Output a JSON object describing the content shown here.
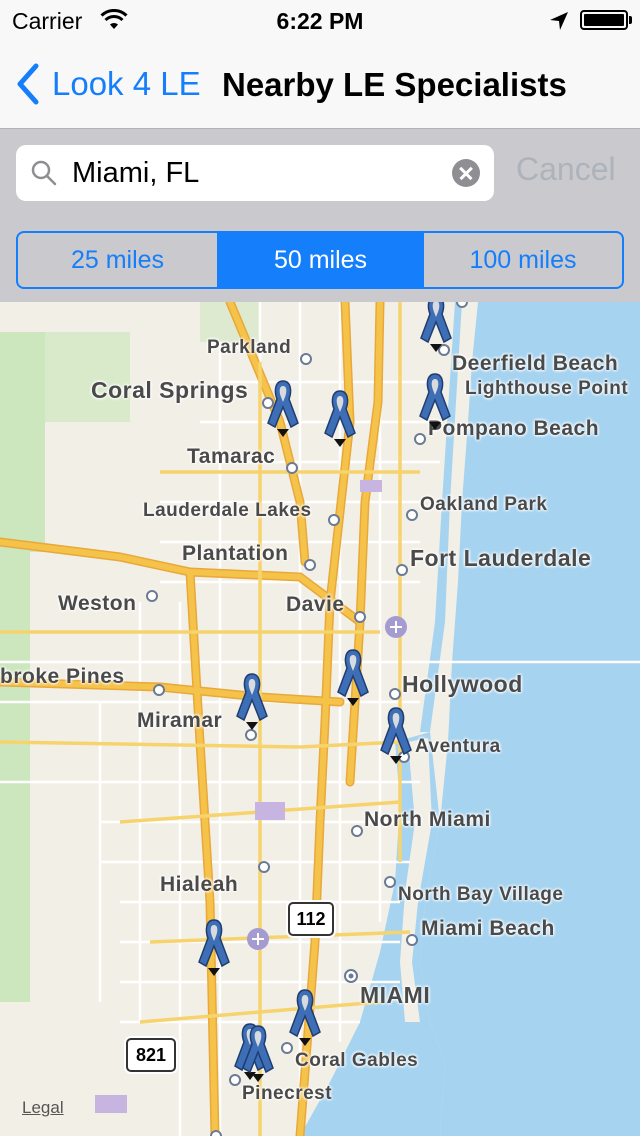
{
  "status": {
    "carrier": "Carrier",
    "time": "6:22 PM"
  },
  "nav": {
    "back_label": "Look 4 LE",
    "title": "Nearby LE Specialists"
  },
  "search": {
    "query": "Miami, FL",
    "cancel_label": "Cancel"
  },
  "segments": [
    {
      "label": "25 miles",
      "selected": false
    },
    {
      "label": "50 miles",
      "selected": true
    },
    {
      "label": "100 miles",
      "selected": false
    }
  ],
  "map": {
    "places": {
      "parkland": "Parkland",
      "deerfield": "Deerfield Beach",
      "coral_springs": "Coral Springs",
      "lighthouse": "Lighthouse Point",
      "pompano": "Pompano Beach",
      "tamarac": "Tamarac",
      "lauderdale_lakes": "Lauderdale Lakes",
      "oakland_park": "Oakland Park",
      "plantation": "Plantation",
      "fort_lauderdale": "Fort Lauderdale",
      "weston": "Weston",
      "davie": "Davie",
      "pembroke": "broke Pines",
      "hollywood": "Hollywood",
      "miramar": "Miramar",
      "aventura": "Aventura",
      "north_miami": "North Miami",
      "hialeah": "Hialeah",
      "north_bay": "North Bay Village",
      "miami_beach": "Miami Beach",
      "miami": "MIAMI",
      "coral_gables": "Coral Gables",
      "pinecrest": "Pinecrest"
    },
    "shields": {
      "sr112": "112",
      "sr821": "821"
    },
    "legal_label": "Legal",
    "pin_icon": "awareness-ribbon-icon",
    "colors": {
      "water": "#a6d3f0",
      "land": "#f2efe6",
      "park": "#c8e6b8",
      "highway": "#f5c24a",
      "ribbon": "#3e6fb6"
    }
  }
}
